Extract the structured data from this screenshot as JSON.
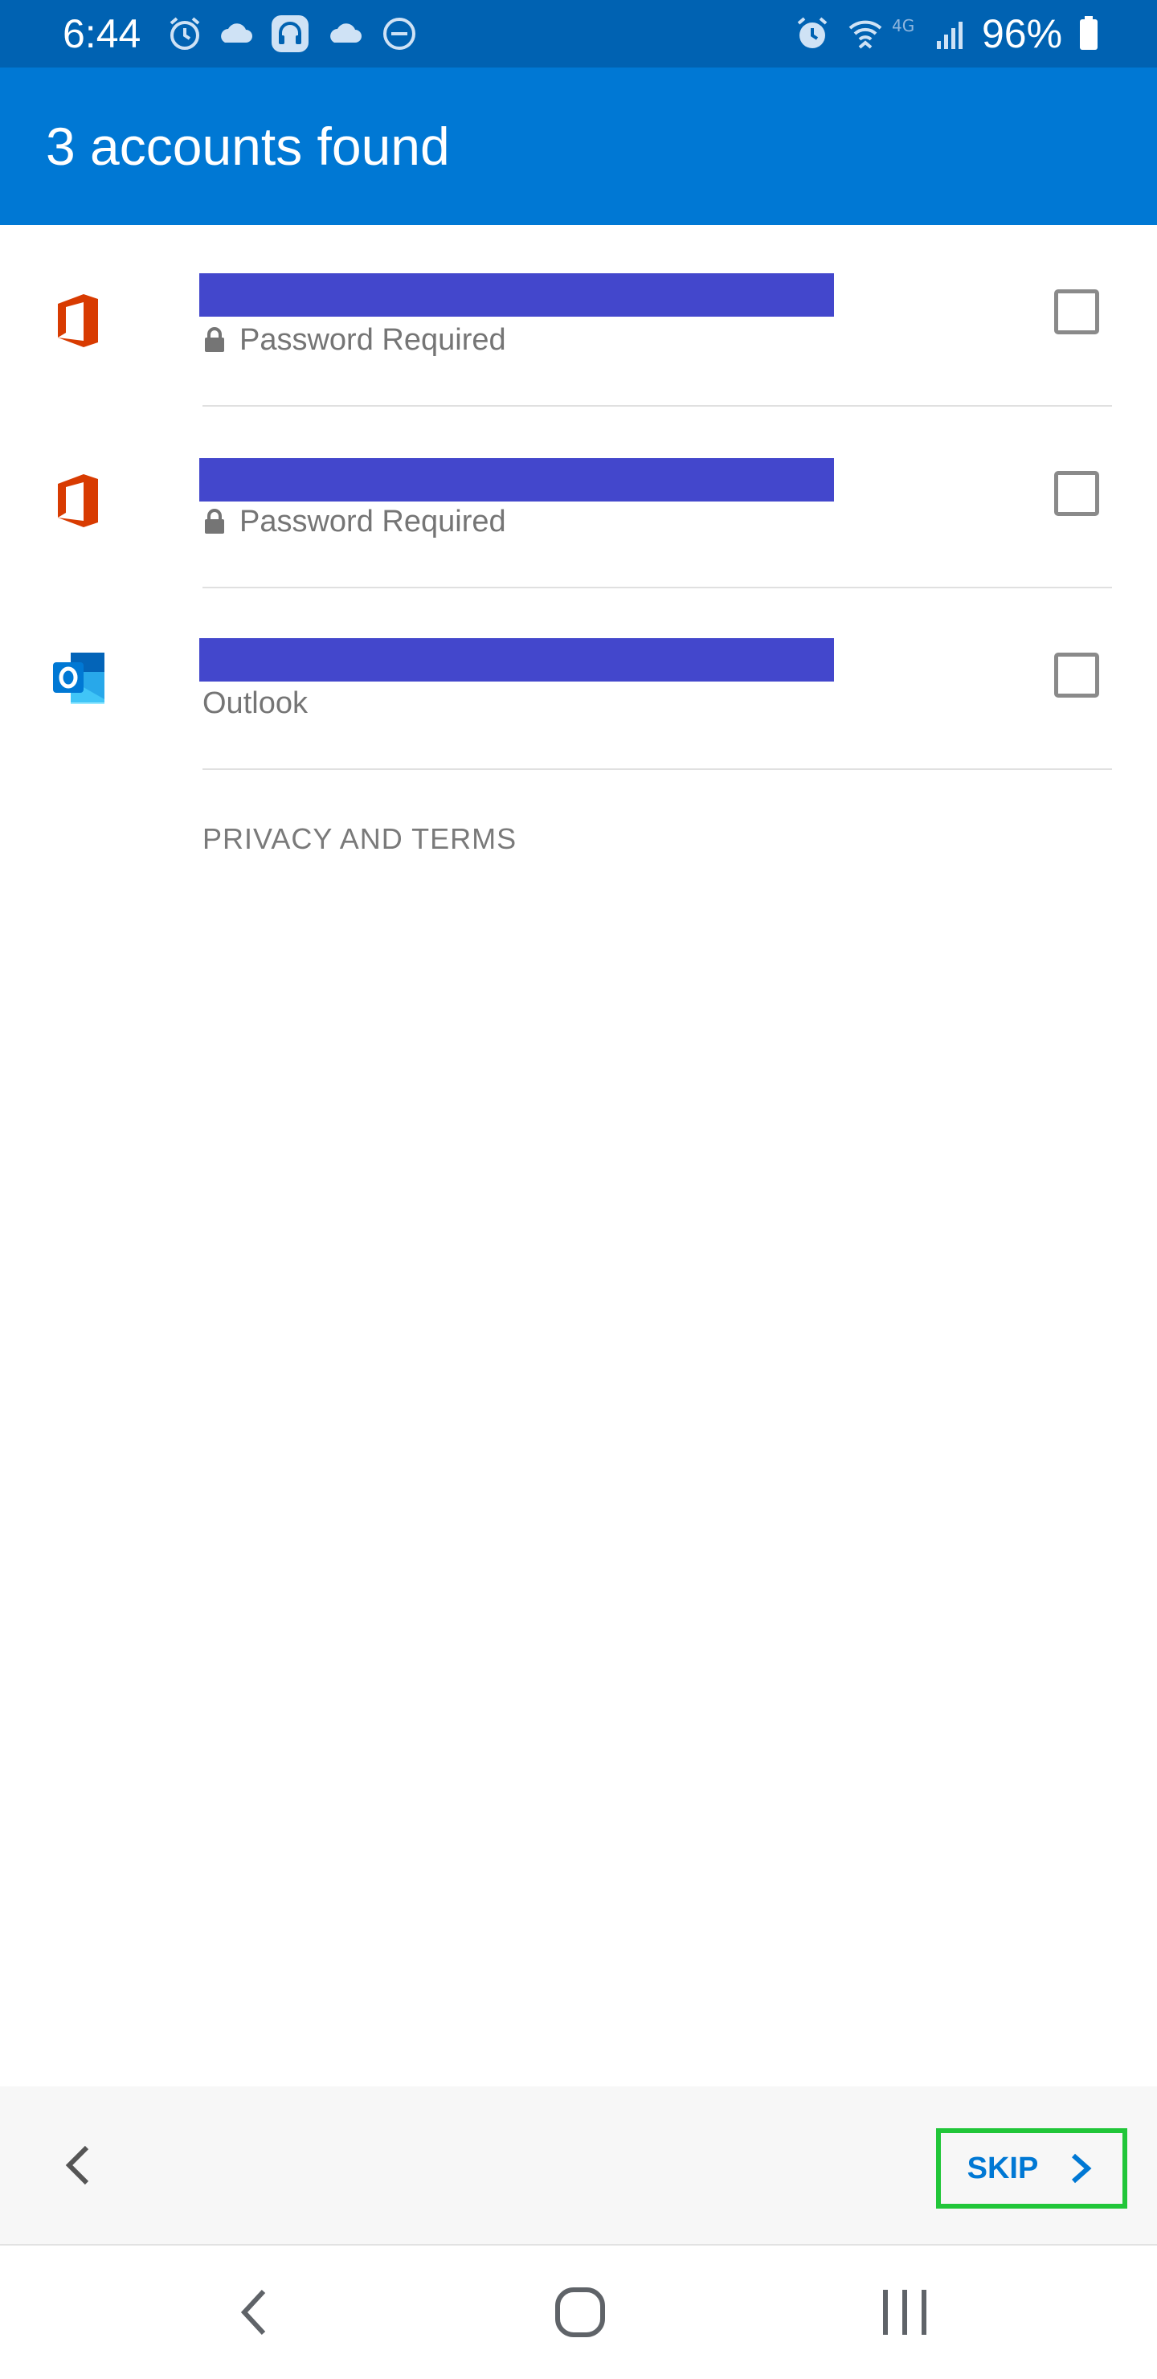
{
  "status_bar": {
    "time": "6:44",
    "battery": "96%",
    "icons": [
      "alarm-icon",
      "cloud-icon",
      "headset-app-icon",
      "cloud-icon",
      "do-not-disturb-icon",
      "alarm-icon",
      "wifi-calling-icon",
      "4g-icon",
      "signal-icon",
      "battery-icon"
    ]
  },
  "header": {
    "title": "3 accounts found"
  },
  "accounts": [
    {
      "icon": "office-icon",
      "subtitle": "Password Required",
      "locked": true,
      "checked": false
    },
    {
      "icon": "office-icon",
      "subtitle": "Password Required",
      "locked": true,
      "checked": false
    },
    {
      "icon": "outlook-icon",
      "subtitle": "Outlook",
      "locked": false,
      "checked": false
    }
  ],
  "links": {
    "privacy": "PRIVACY AND TERMS"
  },
  "footer": {
    "skip_label": "SKIP"
  },
  "colors": {
    "status_bar": "#0062b2",
    "header": "#0078d4",
    "redaction": "#4347cc",
    "office_red": "#d83b01",
    "skip_highlight": "#21c639"
  }
}
